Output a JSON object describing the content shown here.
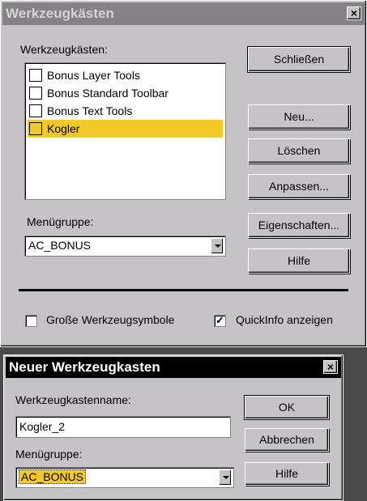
{
  "dialog1": {
    "title": "Werkzeugkästen",
    "close_label": "×",
    "list_label": "Werkzeugkästen:",
    "items": [
      {
        "label": "Bonus Layer Tools",
        "selected": false
      },
      {
        "label": "Bonus Standard Toolbar",
        "selected": false
      },
      {
        "label": "Bonus Text Tools",
        "selected": false
      },
      {
        "label": "Kogler",
        "selected": true
      }
    ],
    "group_label": "Menügruppe:",
    "group_value": "AC_BONUS",
    "buttons": {
      "close": "Schließen",
      "new": "Neu...",
      "delete": "Löschen",
      "customize": "Anpassen...",
      "properties": "Eigenschaften...",
      "help": "Hilfe"
    },
    "large_icons_label": "Große Werkzeugsymbole",
    "large_icons_checked": false,
    "tooltips_label": "QuickInfo anzeigen",
    "tooltips_checked": true,
    "check_mark": "✓"
  },
  "dialog2": {
    "title": "Neuer Werkzeugkasten",
    "close_label": "×",
    "name_label": "Werkzeugkastenname:",
    "name_value": "Kogler_2",
    "group_label": "Menügruppe:",
    "group_value": "AC_BONUS",
    "buttons": {
      "ok": "OK",
      "cancel": "Abbrechen",
      "help": "Hilfe"
    }
  },
  "colors": {
    "selection": "#f2c927",
    "dialog_bg": "#c6c3c6"
  }
}
